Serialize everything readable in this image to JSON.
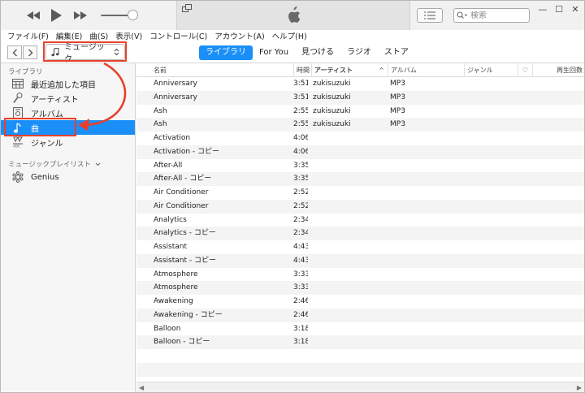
{
  "player": {
    "controls": [
      "rewind-icon",
      "play-icon",
      "fast-forward-icon"
    ],
    "volume_level": 0.85
  },
  "toolbar": {
    "list_button_icon": "list-icon",
    "search_placeholder": "検索",
    "window_buttons": [
      "—",
      "☐",
      "✕"
    ]
  },
  "menu": {
    "items": [
      "ファイル(F)",
      "編集(E)",
      "曲(S)",
      "表示(V)",
      "コントロール(C)",
      "アカウント(A)",
      "ヘルプ(H)"
    ]
  },
  "nav": {
    "back_icon": "chevron-left-icon",
    "forward_icon": "chevron-right-icon",
    "media_selector": "ミュージック",
    "tabs": [
      {
        "label": "ライブラリ",
        "active": true
      },
      {
        "label": "For You",
        "active": false
      },
      {
        "label": "見つける",
        "active": false
      },
      {
        "label": "ラジオ",
        "active": false
      },
      {
        "label": "ストア",
        "active": false
      }
    ]
  },
  "sidebar": {
    "library_header": "ライブラリ",
    "library_items": [
      {
        "label": "最近追加した項目",
        "icon": "calendar-icon",
        "selected": false
      },
      {
        "label": "アーティスト",
        "icon": "microphone-icon",
        "selected": false
      },
      {
        "label": "アルバム",
        "icon": "album-icon",
        "selected": false
      },
      {
        "label": "曲",
        "icon": "music-note-icon",
        "selected": true
      },
      {
        "label": "ジャンル",
        "icon": "genre-icon",
        "selected": false
      }
    ],
    "playlists_header": "ミュージックプレイリスト",
    "playlist_items": [
      {
        "label": "Genius",
        "icon": "genius-icon"
      }
    ]
  },
  "table": {
    "columns": [
      "名前",
      "時間",
      "アーティスト",
      "アルバム",
      "ジャンル",
      "♡",
      "再生回数"
    ],
    "sort_indicator": "^",
    "rows": [
      {
        "name": "Anniversary",
        "time": "3:51",
        "artist": "zukisuzuki",
        "album": "MP3"
      },
      {
        "name": "Anniversary",
        "time": "3:51",
        "artist": "zukisuzuki",
        "album": "MP3"
      },
      {
        "name": "Ash",
        "time": "2:55",
        "artist": "zukisuzuki",
        "album": "MP3"
      },
      {
        "name": "Ash",
        "time": "2:55",
        "artist": "zukisuzuki",
        "album": "MP3"
      },
      {
        "name": "Activation",
        "time": "4:06",
        "artist": "",
        "album": ""
      },
      {
        "name": "Activation - コピー",
        "time": "4:06",
        "artist": "",
        "album": ""
      },
      {
        "name": "After-All",
        "time": "3:35",
        "artist": "",
        "album": ""
      },
      {
        "name": "After-All - コピー",
        "time": "3:35",
        "artist": "",
        "album": ""
      },
      {
        "name": "Air Conditioner",
        "time": "2:52",
        "artist": "",
        "album": ""
      },
      {
        "name": "Air Conditioner",
        "time": "2:52",
        "artist": "",
        "album": ""
      },
      {
        "name": "Analytics",
        "time": "2:34",
        "artist": "",
        "album": ""
      },
      {
        "name": "Analytics - コピー",
        "time": "2:34",
        "artist": "",
        "album": ""
      },
      {
        "name": "Assistant",
        "time": "4:43",
        "artist": "",
        "album": ""
      },
      {
        "name": "Assistant - コピー",
        "time": "4:43",
        "artist": "",
        "album": ""
      },
      {
        "name": "Atmosphere",
        "time": "3:33",
        "artist": "",
        "album": ""
      },
      {
        "name": "Atmosphere",
        "time": "3:33",
        "artist": "",
        "album": ""
      },
      {
        "name": "Awakening",
        "time": "2:46",
        "artist": "",
        "album": ""
      },
      {
        "name": "Awakening - コピー",
        "time": "2:46",
        "artist": "",
        "album": ""
      },
      {
        "name": "Balloon",
        "time": "3:18",
        "artist": "",
        "album": ""
      },
      {
        "name": "Balloon - コピー",
        "time": "3:18",
        "artist": "",
        "album": ""
      },
      {
        "name": "",
        "time": "",
        "artist": "",
        "album": ""
      },
      {
        "name": "",
        "time": "",
        "artist": "",
        "album": ""
      }
    ]
  },
  "scrollbar": {
    "left_icon": "scroll-left-icon",
    "right_icon": "scroll-right-icon"
  },
  "colors": {
    "accent": "#1a8ff8",
    "annotation": "#e8402a"
  }
}
